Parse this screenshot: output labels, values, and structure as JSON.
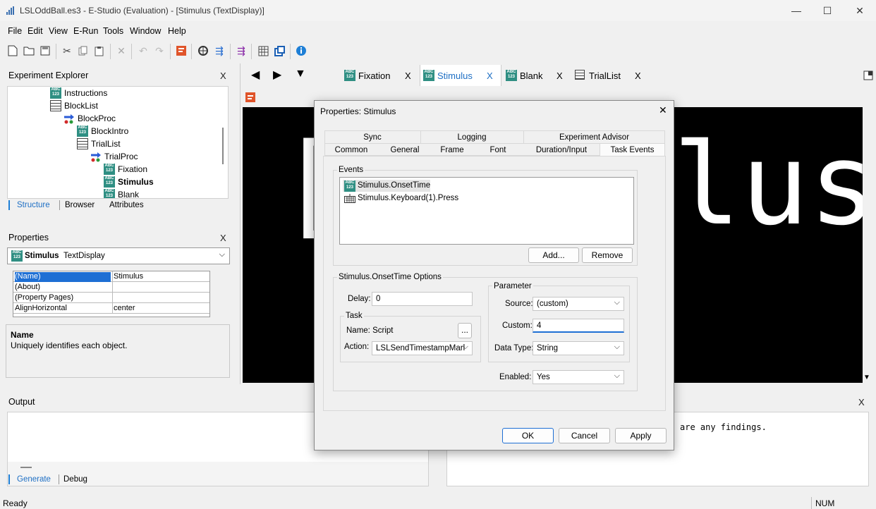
{
  "window": {
    "title": "LSLOddBall.es3 - E-Studio (Evaluation) - [Stimulus  (TextDisplay)]",
    "controls": {
      "minimize": "—",
      "maximize": "☐",
      "close": "✕"
    }
  },
  "menu": [
    "File",
    "Edit",
    "View",
    "E-Run",
    "Tools",
    "Window",
    "Help"
  ],
  "explorer": {
    "title": "Experiment Explorer",
    "close": "X",
    "items": [
      {
        "label": "Instructions",
        "icon": "text-display-icon"
      },
      {
        "label": "BlockList",
        "icon": "list-icon"
      },
      {
        "label": "BlockProc",
        "icon": "procedure-icon"
      },
      {
        "label": "BlockIntro",
        "icon": "text-display-icon"
      },
      {
        "label": "TrialList",
        "icon": "list-icon"
      },
      {
        "label": "TrialProc",
        "icon": "procedure-icon"
      },
      {
        "label": "Fixation",
        "icon": "text-display-icon"
      },
      {
        "label": "Stimulus",
        "icon": "text-display-icon"
      },
      {
        "label": "Blank",
        "icon": "text-display-icon"
      }
    ],
    "tabs": [
      "Structure",
      "Browser",
      "Attributes"
    ]
  },
  "properties": {
    "title": "Properties",
    "close": "X",
    "object_name": "Stimulus",
    "object_type": "TextDisplay",
    "rows": [
      {
        "key": "(Name)",
        "value": "Stimulus"
      },
      {
        "key": "(About)",
        "value": ""
      },
      {
        "key": "(Property Pages)",
        "value": ""
      },
      {
        "key": "AlignHorizontal",
        "value": "center"
      }
    ],
    "desc_title": "Name",
    "desc_text": "Uniquely identifies each object."
  },
  "doc_tabs": [
    {
      "label": "Fixation",
      "close": "X"
    },
    {
      "label": "Stimulus",
      "close": "X"
    },
    {
      "label": "Blank",
      "close": "X"
    },
    {
      "label": "TrialList",
      "close": "X"
    }
  ],
  "canvas": {
    "text_left": "[",
    "text_right": "lus"
  },
  "output": {
    "title": "Output",
    "tabs": [
      "Generate",
      "Debug"
    ],
    "right_close": "X",
    "right_text": "are any findings."
  },
  "status": {
    "left": "Ready",
    "right": "NUM"
  },
  "dialog": {
    "title": "Properties: Stimulus",
    "close": "✕",
    "tabs_row1": [
      "Sync",
      "Logging",
      "Experiment Advisor"
    ],
    "tabs_row2": [
      "Common",
      "General",
      "Frame",
      "Font",
      "Duration/Input",
      "Task Events"
    ],
    "events_label": "Events",
    "events": [
      "Stimulus.OnsetTime",
      "Stimulus.Keyboard(1).Press"
    ],
    "add_button": "Add...",
    "remove_button": "Remove",
    "options_label": "Stimulus.OnsetTime Options",
    "delay_label": "Delay:",
    "delay_value": "0",
    "task_label": "Task",
    "name_label": "Name:  Script",
    "browse_button": "...",
    "action_label": "Action:",
    "action_value": "LSLSendTimestampMarl",
    "parameter_label": "Parameter",
    "source_label": "Source:",
    "source_value": "(custom)",
    "custom_label": "Custom:",
    "custom_value": "4",
    "datatype_label": "Data Type:",
    "datatype_value": "String",
    "enabled_label": "Enabled:",
    "enabled_value": "Yes",
    "ok": "OK",
    "cancel": "Cancel",
    "apply": "Apply"
  }
}
